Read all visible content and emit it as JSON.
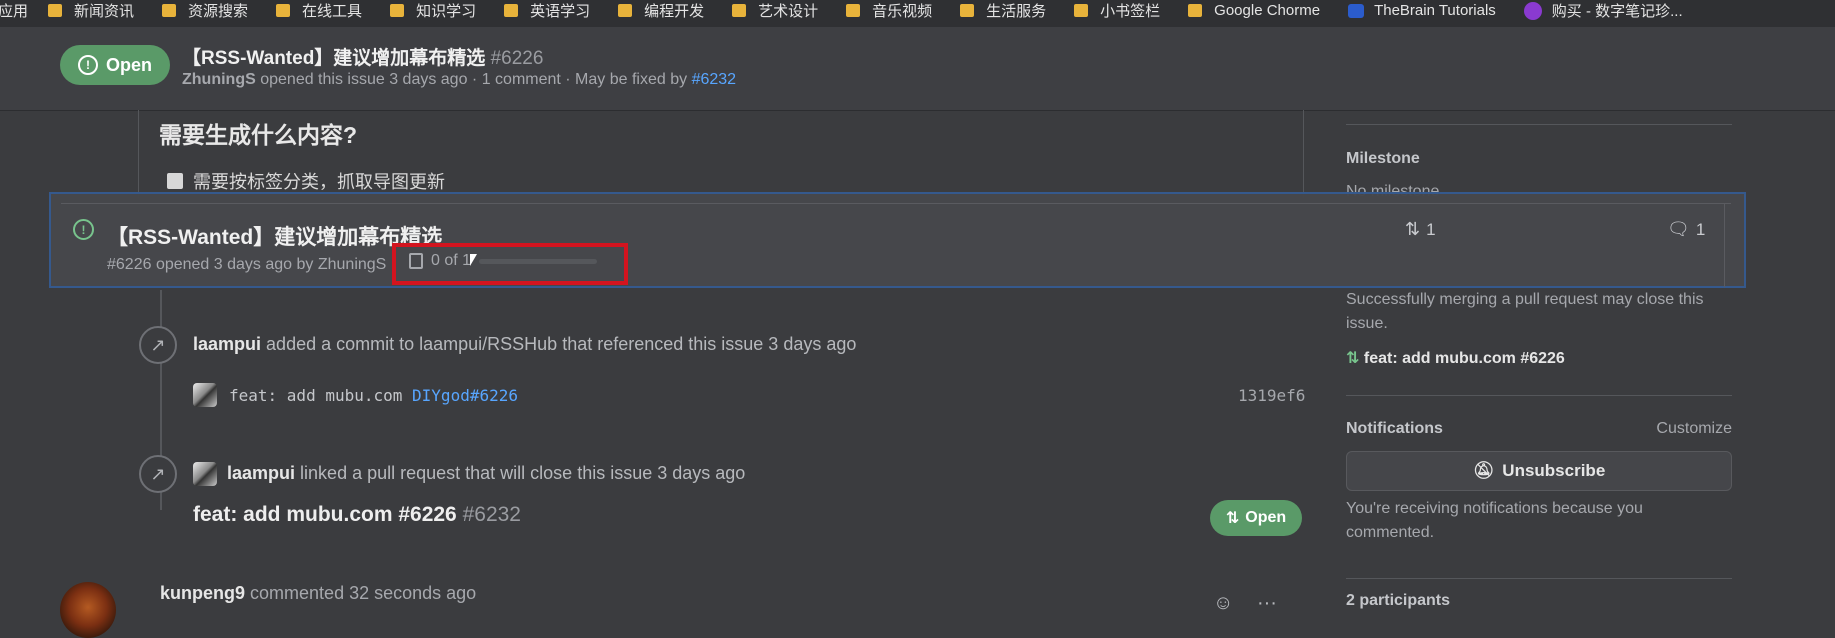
{
  "bookmarks": [
    {
      "label": "应用",
      "icon": "apps-icon"
    },
    {
      "label": "新闻资讯",
      "icon": "folder-icon"
    },
    {
      "label": "资源搜索",
      "icon": "folder-icon"
    },
    {
      "label": "在线工具",
      "icon": "folder-icon"
    },
    {
      "label": "知识学习",
      "icon": "folder-icon"
    },
    {
      "label": "英语学习",
      "icon": "folder-icon"
    },
    {
      "label": "编程开发",
      "icon": "folder-icon"
    },
    {
      "label": "艺术设计",
      "icon": "folder-icon"
    },
    {
      "label": "音乐视频",
      "icon": "folder-icon"
    },
    {
      "label": "生活服务",
      "icon": "folder-icon"
    },
    {
      "label": "小书签栏",
      "icon": "folder-icon"
    },
    {
      "label": "Google Chorme",
      "icon": "folder-icon"
    },
    {
      "label": "TheBrain Tutorials",
      "icon": "brain-icon"
    },
    {
      "label": "购买 - 数字笔记珍...",
      "icon": "diamond-icon"
    }
  ],
  "header": {
    "state": "Open",
    "title": "【RSS-Wanted】建议增加幕布精选",
    "number": "#6226",
    "author": "ZhuningS",
    "meta_text": "opened this issue 3 days ago · 1 comment · May be fixed by",
    "fixed_by": "#6232"
  },
  "comment": {
    "heading": "需要生成什么内容?",
    "task": "需要按标签分类，抓取导图更新"
  },
  "hovercard": {
    "title": "【RSS-Wanted】建议增加幕布精选",
    "meta": "#6226 opened 3 days ago by ZhuningS",
    "tasks": "0 of 1",
    "linked_prs": "1",
    "comments": "1"
  },
  "sidebar": {
    "milestone_heading": "Milestone",
    "milestone_value": "No milestone",
    "linked_note": "Successfully merging a pull request may close this issue.",
    "linked_pr": "feat: add mubu.com #6226",
    "notifications_heading": "Notifications",
    "customize": "Customize",
    "unsubscribe": "Unsubscribe",
    "notify_reason": "You're receiving notifications because you commented.",
    "participants": "2 participants"
  },
  "timeline": {
    "event1": {
      "user": "laampui",
      "text": "added a commit to laampui/RSSHub that referenced this issue 3 days ago"
    },
    "commit": {
      "message": "feat: add mubu.com",
      "ref": "DIYgod#6226",
      "sha": "1319ef6"
    },
    "event2": {
      "user": "laampui",
      "text": "linked a pull request that will close this issue 3 days ago"
    },
    "pr": {
      "title": "feat: add mubu.com #6226",
      "number": "#6232",
      "state": "Open"
    },
    "next_comment": {
      "user": "kunpeng9",
      "text": "commented 32 seconds ago"
    }
  }
}
